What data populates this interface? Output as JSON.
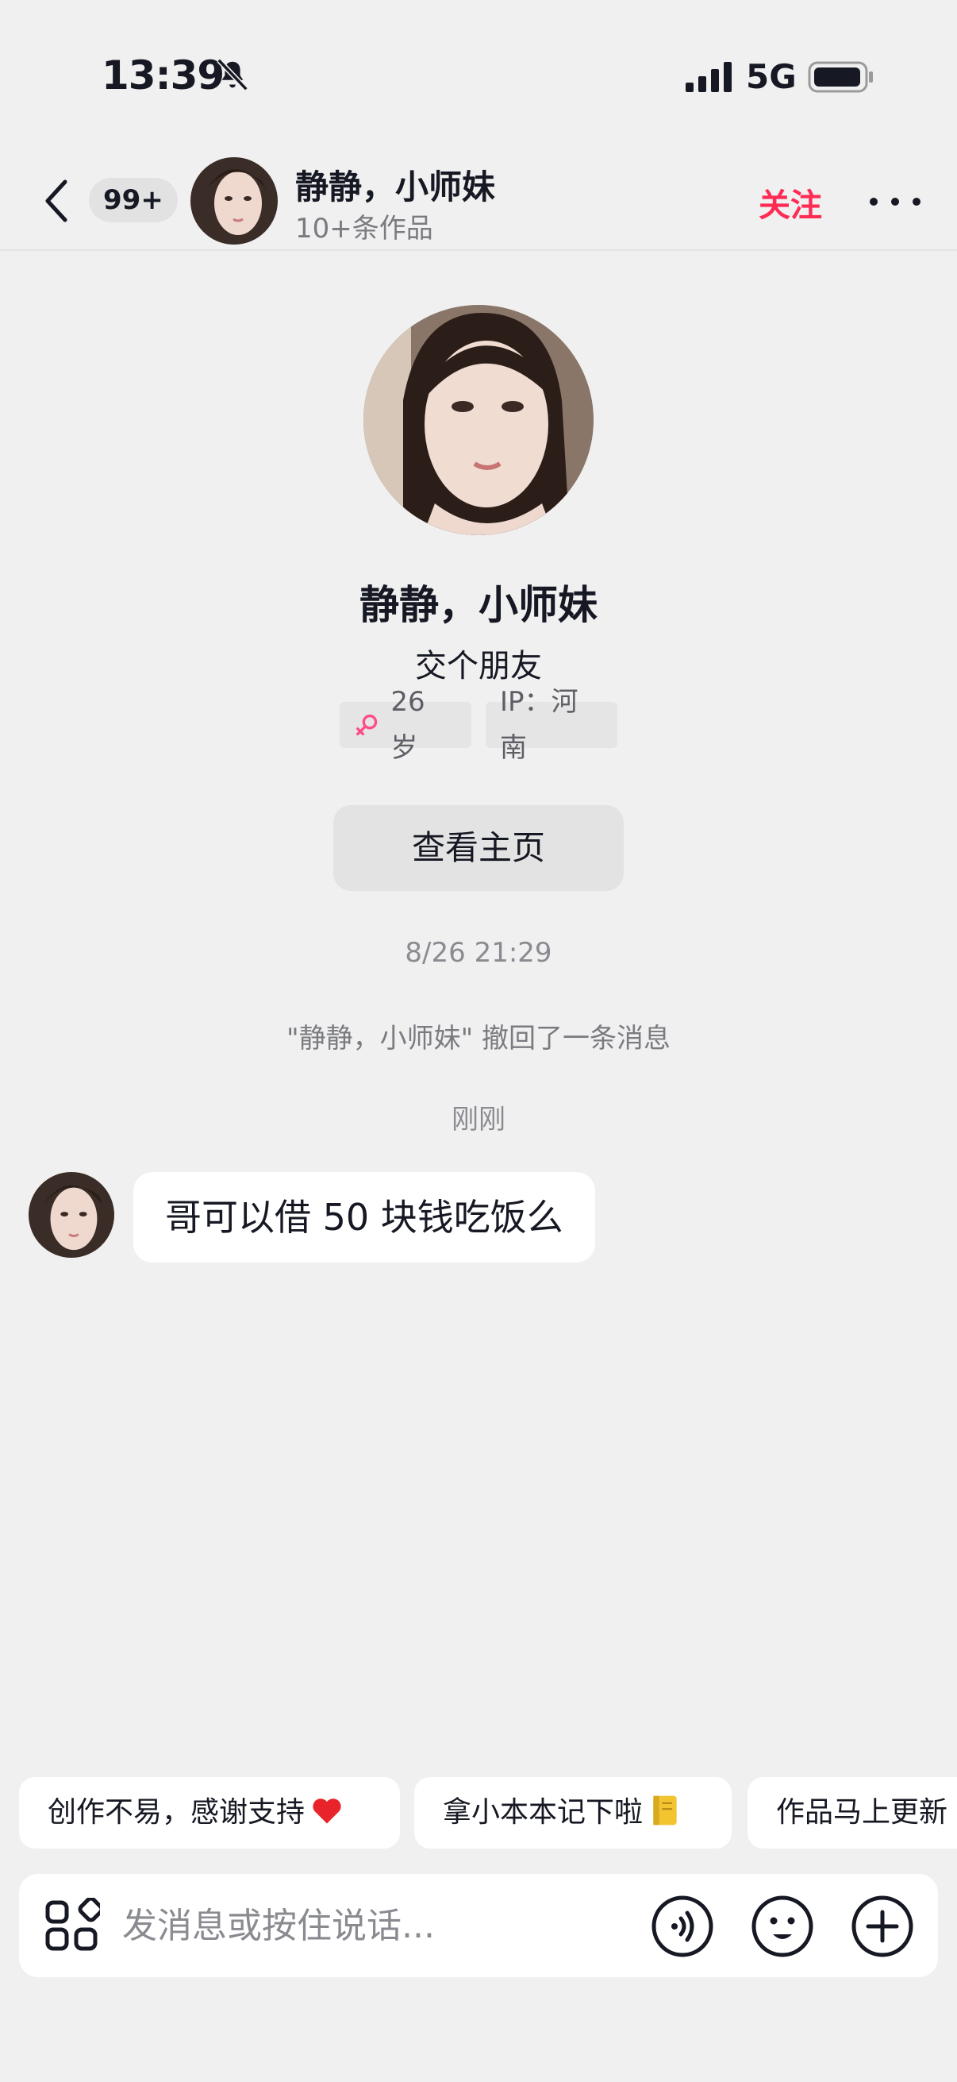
{
  "status_bar": {
    "time": "13:39",
    "network": "5G",
    "icons": [
      "bell-slash-icon",
      "signal-icon",
      "battery-icon"
    ]
  },
  "header": {
    "back_icon": "chevron-left-icon",
    "unread_count": "99+",
    "name": "静静，小师妹",
    "subtitle": "10+条作品",
    "follow_label": "关注",
    "more_icon": "more-dots-icon"
  },
  "profile": {
    "name": "静静，小师妹",
    "bio": "交个朋友",
    "age_tag": "26 岁",
    "ip_tag": "IP：河南",
    "view_profile_label": "查看主页"
  },
  "messages": {
    "timestamp_1": "8/26 21:29",
    "recall_notice": "\"静静，小师妹\" 撤回了一条消息",
    "timestamp_2": "刚刚",
    "incoming_text": "哥可以借 50 块钱吃饭么"
  },
  "quick_replies": [
    {
      "label": "创作不易，感谢支持",
      "emoji": "heart-icon"
    },
    {
      "label": "拿小本本记下啦",
      "emoji": "notebook-icon"
    },
    {
      "label": "作品马上更新"
    }
  ],
  "input_bar": {
    "placeholder": "发消息或按住说话...",
    "icons": [
      "apps-icon",
      "voice-icon",
      "emoji-icon",
      "plus-icon"
    ]
  },
  "colors": {
    "accent": "#fe2c55",
    "background": "#f0f0f0",
    "bubble": "#ffffff"
  }
}
